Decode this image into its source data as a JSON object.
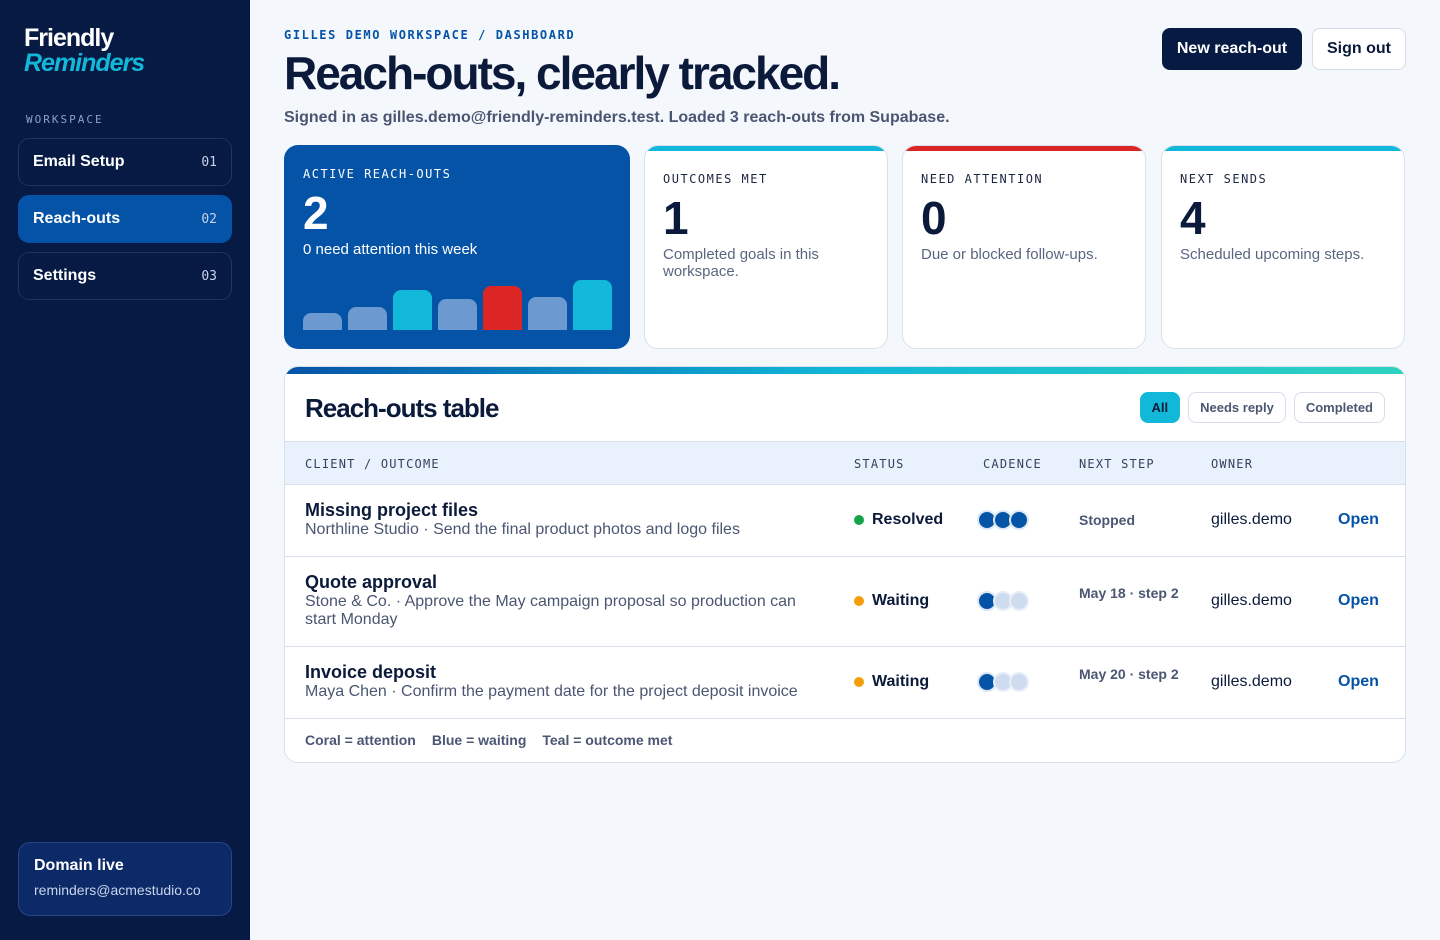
{
  "brand": {
    "line1": "Friendly",
    "line2": "Reminders"
  },
  "sidebar": {
    "section_label": "WORKSPACE",
    "items": [
      {
        "label": "Email Setup",
        "num": "01",
        "active": false
      },
      {
        "label": "Reach-outs",
        "num": "02",
        "active": true
      },
      {
        "label": "Settings",
        "num": "03",
        "active": false
      }
    ],
    "domain": {
      "title": "Domain live",
      "email": "reminders@acmestudio.co"
    }
  },
  "header": {
    "breadcrumb": "GILLES DEMO WORKSPACE / DASHBOARD",
    "title": "Reach-outs, clearly tracked.",
    "signed_in": "Signed in as gilles.demo@friendly-reminders.test. Loaded 3 reach-outs from Supabase.",
    "new_button": "New reach-out",
    "signout_button": "Sign out"
  },
  "stats": {
    "active": {
      "label": "ACTIVE REACH-OUTS",
      "value": "2",
      "sub": "0 need attention this week",
      "bars": [
        {
          "value": 0.34,
          "color": "#6c9ad0"
        },
        {
          "value": 0.46,
          "color": "#6c9ad0"
        },
        {
          "value": 0.8,
          "color": "#12b8d9"
        },
        {
          "value": 0.62,
          "color": "#6c9ad0"
        },
        {
          "value": 0.88,
          "color": "#dc2626"
        },
        {
          "value": 0.66,
          "color": "#6c9ad0"
        },
        {
          "value": 1.0,
          "color": "#12b8d9"
        }
      ]
    },
    "outcomes": {
      "label": "OUTCOMES MET",
      "value": "1",
      "sub": "Completed goals in this workspace.",
      "accent": "#12b8d9"
    },
    "attention": {
      "label": "NEED ATTENTION",
      "value": "0",
      "sub": "Due or blocked follow-ups.",
      "accent": "#dc2626"
    },
    "sends": {
      "label": "NEXT SENDS",
      "value": "4",
      "sub": "Scheduled upcoming steps.",
      "accent": "#12b8d9"
    }
  },
  "table": {
    "title": "Reach-outs table",
    "filters": [
      {
        "label": "All",
        "active": true
      },
      {
        "label": "Needs reply",
        "active": false
      },
      {
        "label": "Completed",
        "active": false
      }
    ],
    "columns": [
      "CLIENT / OUTCOME",
      "STATUS",
      "CADENCE",
      "NEXT STEP",
      "OWNER"
    ],
    "rows": [
      {
        "title": "Missing project files",
        "desc": "Northline Studio · Send the final product photos and logo files",
        "status": "Resolved",
        "status_color": "#16a34a",
        "cadence": [
          true,
          true,
          true
        ],
        "next": "Stopped",
        "owner": "gilles.demo",
        "action": "Open"
      },
      {
        "title": "Quote approval",
        "desc": "Stone & Co. · Approve the May campaign proposal so production can start Monday",
        "status": "Waiting",
        "status_color": "#f59e0b",
        "cadence": [
          true,
          false,
          false
        ],
        "next": "May 18 · step 2",
        "owner": "gilles.demo",
        "action": "Open"
      },
      {
        "title": "Invoice deposit",
        "desc": "Maya Chen · Confirm the payment date for the project deposit invoice",
        "status": "Waiting",
        "status_color": "#f59e0b",
        "cadence": [
          true,
          false,
          false
        ],
        "next": "May 20 · step 2",
        "owner": "gilles.demo",
        "action": "Open"
      }
    ],
    "legend": [
      "Coral = attention",
      "Blue = waiting",
      "Teal = outcome met"
    ]
  }
}
